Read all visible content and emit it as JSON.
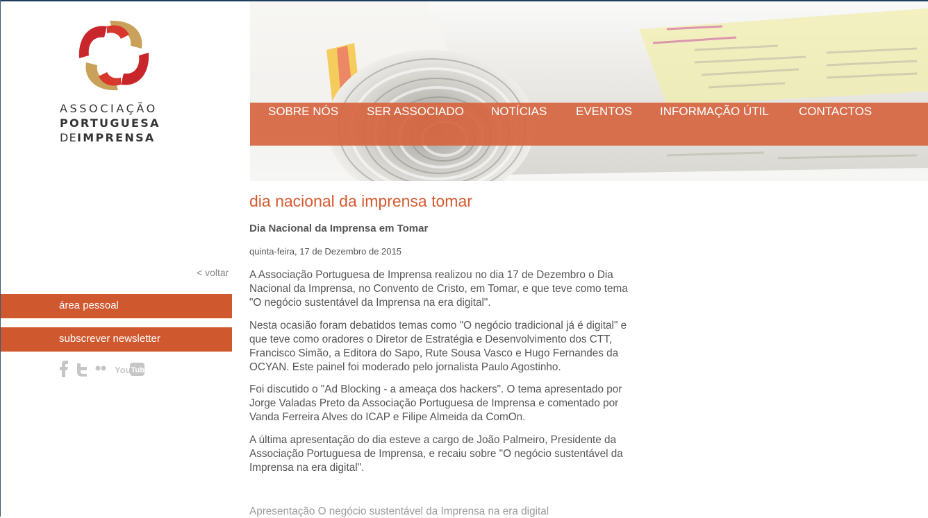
{
  "brand": {
    "logo_line1": "ASSOCIAÇÃO",
    "logo_line2": "PORTUGUESA",
    "logo_line3_a": "DE",
    "logo_line3_b": "IMPRENSA",
    "colors": {
      "red": "#c8262a",
      "gold": "#c9a15a",
      "orange": "#d0582f"
    }
  },
  "nav": {
    "items": [
      "SOBRE NÓS",
      "SER ASSOCIADO",
      "NOTÍCIAS",
      "EVENTOS",
      "INFORMAÇÃO ÚTIL",
      "CONTACTOS"
    ]
  },
  "sidebar": {
    "back": "< voltar",
    "personal_area": "área pessoal",
    "newsletter": "subscrever newsletter",
    "social_icons": [
      "facebook-icon",
      "twitter-icon",
      "flickr-icon",
      "youtube-icon"
    ]
  },
  "article": {
    "title": "dia nacional da imprensa tomar",
    "subtitle": "Dia Nacional da Imprensa em Tomar",
    "date": "quinta-feira, 17 de Dezembro de 2015",
    "paragraphs": [
      [
        "A Associação Portuguesa  de Imprensa realizou no dia 17 de Dezembro o Dia",
        "Nacional da Imprensa, no Convento de Cristo, em Tomar, e que teve como tema",
        " \"O negócio sustentável da Imprensa na era digital\"."
      ],
      [
        "Nesta ocasião foram debatidos temas como \"O negócio tradicional já é digital\" e",
        "que teve como oradores o Diretor de Estratégia e Desenvolvimento dos CTT,",
        "Francisco Simão, a Editora do Sapo, Rute Sousa Vasco e Hugo Fernandes da",
        "OCYAN. Este painel foi moderado pelo jornalista Paulo Agostinho."
      ],
      [
        "Foi discutido o \"Ad Blocking - a ameaça dos hackers\". O tema apresentado por",
        "Jorge Valadas Preto da Associação Portuguesa de Imprensa e comentado por",
        "Vanda Ferreira Alves do ICAP e Filipe Almeida da ComOn."
      ],
      [
        "A última apresentação do dia esteve a cargo de João Palmeiro, Presidente da",
        "Associação Portuguesa de Imprensa, e recaiu sobre \"O negócio sustentável da",
        "Imprensa na era digital\"."
      ]
    ],
    "attachment": "Apresentação O negócio sustentável da Imprensa na era digital"
  }
}
